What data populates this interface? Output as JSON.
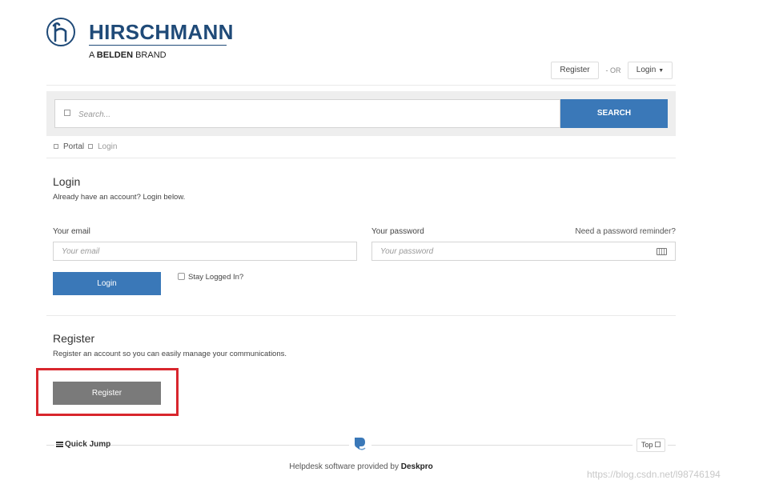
{
  "brand": {
    "name": "HIRSCHMANN",
    "tagline_prefix": "A",
    "tagline_brand": "BELDEN",
    "tagline_suffix": "BRAND",
    "color": "#1f4a78"
  },
  "header": {
    "register_label": "Register",
    "or_label": "OR",
    "login_label": "Login"
  },
  "search": {
    "placeholder": "Search...",
    "button_label": "SEARCH",
    "accent": "#3a78b8"
  },
  "breadcrumb": {
    "items": [
      "Portal",
      "Login"
    ]
  },
  "login": {
    "title": "Login",
    "subtitle": "Already have an account? Login below.",
    "email_label": "Your email",
    "email_placeholder": "Your email",
    "password_label": "Your password",
    "password_placeholder": "Your password",
    "reminder_link": "Need a password reminder?",
    "submit_label": "Login",
    "stay_logged_in": "Stay Logged In?"
  },
  "register": {
    "title": "Register",
    "subtitle": "Register an account so you can easily manage your communications.",
    "button_label": "Register",
    "highlight_color": "#d8262d"
  },
  "footer": {
    "quick_jump": "Quick Jump",
    "top_label": "Top",
    "powered_prefix": "Helpdesk software provided by",
    "powered_brand": "Deskpro"
  },
  "watermark": "https://blog.csdn.net/l98746194",
  "icons": {
    "logo": "h-logo-icon",
    "search": "search-icon",
    "keyboard": "keyboard-icon",
    "menu": "menu-icon",
    "deskpro": "deskpro-icon"
  }
}
